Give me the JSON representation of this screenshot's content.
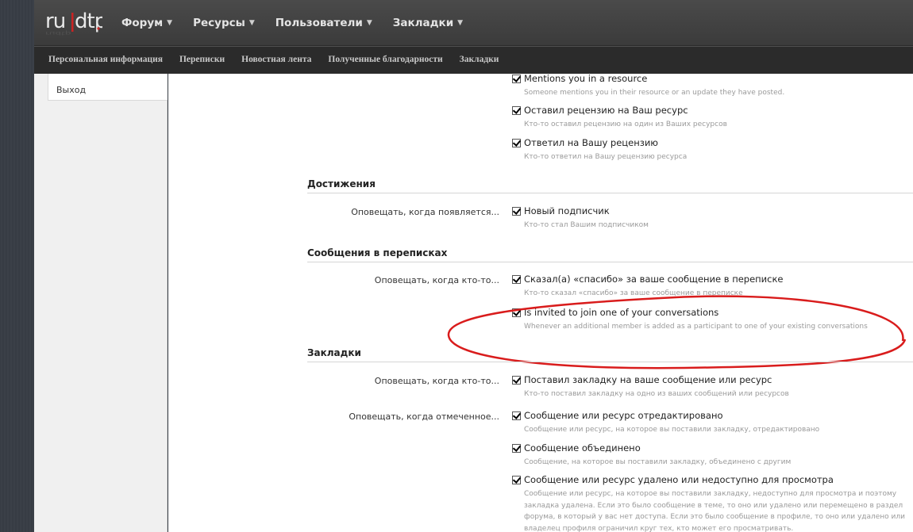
{
  "header": {
    "logo_text": "ru|dtp",
    "nav": [
      {
        "label": "Форум",
        "caret": "▼"
      },
      {
        "label": "Ресурсы",
        "caret": "▼"
      },
      {
        "label": "Пользователи",
        "caret": "▼"
      },
      {
        "label": "Закладки",
        "caret": "▼"
      }
    ]
  },
  "subnav": [
    "Персональная информация",
    "Переписки",
    "Новостная лента",
    "Полученные благодарности",
    "Закладки"
  ],
  "sidebar": {
    "logout_label": "Выход"
  },
  "colors": {
    "highlight_ellipse": "#d91c1c",
    "logo_accent": "#cc2222"
  },
  "top_options": [
    {
      "label": "Mentions you in a resource",
      "desc": "Someone mentions you in their resource or an update they have posted."
    },
    {
      "label": "Оставил рецензию на Ваш ресурс",
      "desc": "Кто-то оставил рецензию на один из Ваших ресурсов"
    },
    {
      "label": "Ответил на Вашу рецензию",
      "desc": "Кто-то ответил на Вашу рецензию ресурса"
    }
  ],
  "achievements": {
    "title": "Достижения",
    "row_label": "Оповещать, когда появляется...",
    "options": [
      {
        "label": "Новый подписчик",
        "desc": "Кто-то стал Вашим подписчиком"
      }
    ]
  },
  "conversations": {
    "title": "Сообщения в переписках",
    "row_label": "Оповещать, когда кто-то...",
    "options": [
      {
        "label": "Сказал(а) «спасибо» за ваше сообщение в переписке",
        "desc": "Кто-то сказал «спасибо» за ваше сообщение в переписке"
      },
      {
        "label": "Is invited to join one of your conversations",
        "desc": "Whenever an additional member is added as a participant to one of your existing conversations"
      }
    ]
  },
  "bookmarks": {
    "title": "Закладки",
    "row_label_1": "Оповещать, когда кто-то...",
    "row_label_2": "Оповещать, когда отмеченное...",
    "options_1": [
      {
        "label": "Поставил закладку на ваше сообщение или ресурс",
        "desc": "Кто-то поставил закладку на одно из ваших сообщений или ресурсов"
      }
    ],
    "options_2": [
      {
        "label": "Сообщение или ресурс отредактировано",
        "desc": "Сообщение или ресурс, на которое вы поставили закладку, отредактировано"
      },
      {
        "label": "Сообщение объединено",
        "desc": "Сообщение, на которое вы поставили закладку, объединено с другим"
      },
      {
        "label": "Сообщение или ресурс удалено или недоступно для просмотра",
        "desc_lines": [
          "Сообщение или ресурс, на которое вы поставили закладку, недоступно для просмотра и поэтому",
          "закладка удалена. Если это было сообщение в теме, то оно или удалено или перемещено в раздел",
          "форума, в который у вас нет доступа. Если это было сообщение в профиле, то оно или удалено или",
          "владелец профиля ограничил круг тех, кто может его просматривать."
        ]
      }
    ]
  }
}
